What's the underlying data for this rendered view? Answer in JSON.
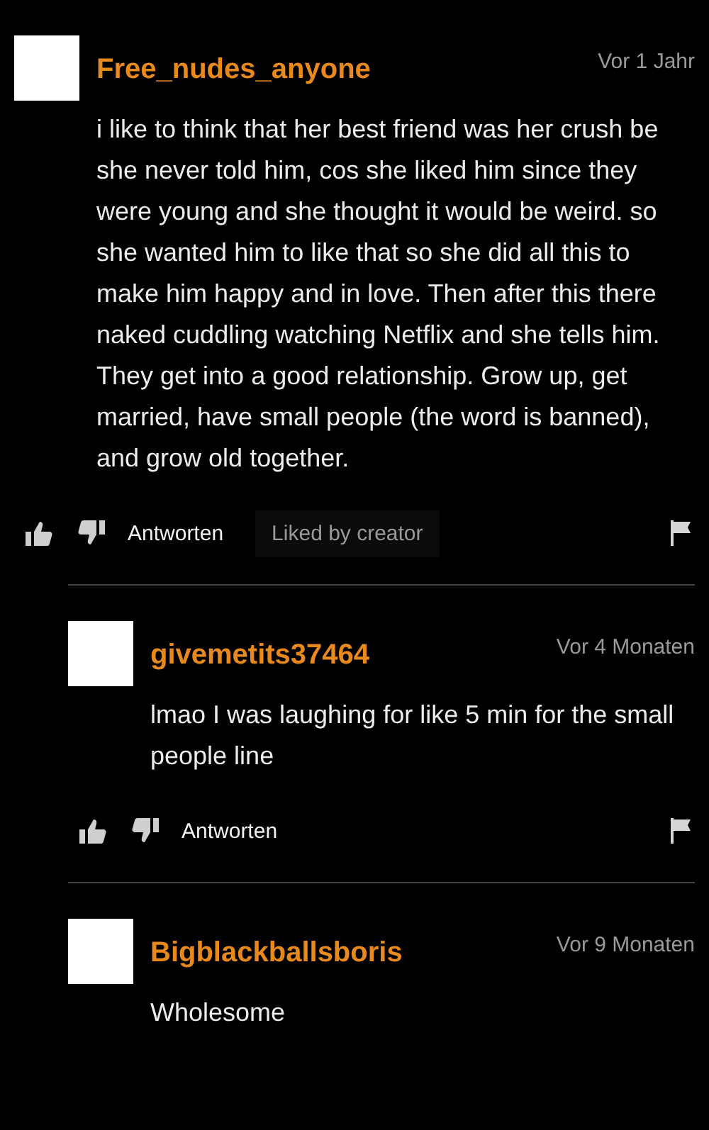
{
  "comments": [
    {
      "kind": "comment",
      "username": "Free_nudes_anyone",
      "time": "Vor 1 Jahr",
      "text": "i like to think that her best friend was her crush be she never told him, cos she liked him since they were young and she thought it would be weird. so she wanted him to like that so she did all this to make him happy and in love. Then after this there naked cuddling watching Netflix and she tells him. They get into a good relationship. Grow up, get married, have small people (the word is banned), and grow old together.",
      "reply_label": "Antworten",
      "badge": "Liked by creator"
    },
    {
      "kind": "reply",
      "username": "givemetits37464",
      "time": "Vor 4 Monaten",
      "text": "lmao I was laughing for like 5 min for the small people line",
      "reply_label": "Antworten"
    },
    {
      "kind": "reply",
      "username": "Bigblackballsboris",
      "time": "Vor 9 Monaten",
      "text": "Wholesome"
    }
  ]
}
